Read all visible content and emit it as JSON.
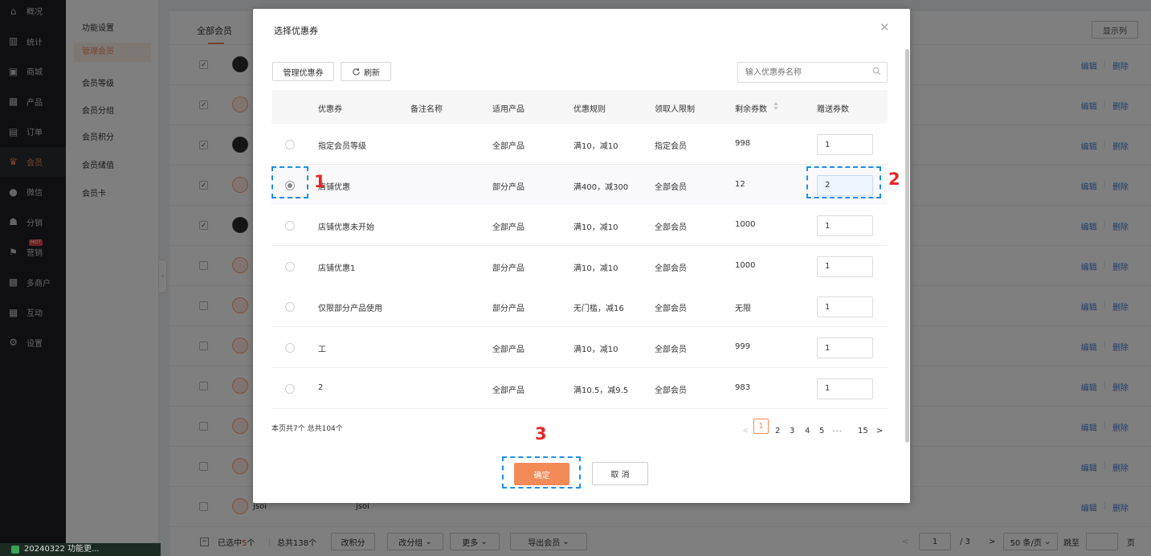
{
  "nav": {
    "items": [
      {
        "label": "概况",
        "icon": "graduation-cap-icon",
        "glyph": "⌂"
      },
      {
        "label": "统计",
        "icon": "chart-icon",
        "glyph": "▥"
      },
      {
        "label": "商城",
        "icon": "shop-icon",
        "glyph": "▣"
      },
      {
        "label": "产品",
        "icon": "grid-icon",
        "glyph": "▦"
      },
      {
        "label": "订单",
        "icon": "order-icon",
        "glyph": "▤"
      },
      {
        "label": "会员",
        "icon": "crown-icon",
        "glyph": "♛"
      },
      {
        "label": "微信",
        "icon": "wechat-icon",
        "glyph": "●"
      },
      {
        "label": "分销",
        "icon": "users-icon",
        "glyph": "☗"
      },
      {
        "label": "营销",
        "icon": "flag-icon",
        "glyph": "⚑"
      },
      {
        "label": "多商户",
        "icon": "merchant-icon",
        "glyph": "▩"
      },
      {
        "label": "互动",
        "icon": "interact-icon",
        "glyph": "▦"
      },
      {
        "label": "设置",
        "icon": "gear-icon",
        "glyph": "⚙"
      }
    ],
    "active_index": 5,
    "hot_badge": "HOT"
  },
  "subnav": {
    "items": [
      "功能设置",
      "管理会员",
      "会员等级",
      "会员分组",
      "会员积分",
      "会员储值",
      "会员卡"
    ],
    "active_index": 1
  },
  "page": {
    "tab": "全部会员",
    "show_columns": "显示列",
    "row_ops": {
      "edit": "编辑",
      "delete": "删除"
    },
    "last_row_name": "jsoi",
    "last_row_name2": "jsoi",
    "footer": {
      "selected_prefix": "已选中",
      "selected_count": "5",
      "selected_suffix": "个",
      "total": "总共138个",
      "change_points": "改积分",
      "change_group": "改分组",
      "more": "更多",
      "export": "导出会员",
      "current_page": "1",
      "total_pages": "/ 3",
      "page_size": "50 条/页",
      "jump_to": "跳至",
      "page_unit": "页"
    }
  },
  "taskbar": {
    "text": "20240322 功能更..."
  },
  "modal": {
    "title": "选择优惠券",
    "manage_btn": "管理优惠券",
    "refresh_btn": "刷新",
    "search_placeholder": "输入优惠券名称",
    "columns": {
      "coupon": "优惠券",
      "remark": "备注名称",
      "product": "适用产品",
      "rule": "优惠规则",
      "limit": "领取人限制",
      "remaining": "剩余券数",
      "gift": "赠送券数"
    },
    "rows": [
      {
        "name": "指定会员等级",
        "remark": "",
        "product": "全部产品",
        "rule": "满10，减10",
        "limit": "指定会员",
        "remaining": "998",
        "qty": "1"
      },
      {
        "name": "店铺优惠",
        "remark": "",
        "product": "部分产品",
        "rule": "满400，减300",
        "limit": "全部会员",
        "remaining": "12",
        "qty": "2"
      },
      {
        "name": "店铺优惠未开始",
        "remark": "",
        "product": "全部产品",
        "rule": "满10，减10",
        "limit": "全部会员",
        "remaining": "1000",
        "qty": "1"
      },
      {
        "name": "店铺优惠1",
        "remark": "",
        "product": "部分产品",
        "rule": "满10，减10",
        "limit": "全部会员",
        "remaining": "1000",
        "qty": "1"
      },
      {
        "name": "仅限部分产品使用",
        "remark": "",
        "product": "部分产品",
        "rule": "无门槛，减16",
        "limit": "全部会员",
        "remaining": "无限",
        "qty": "1"
      },
      {
        "name": "工",
        "remark": "",
        "product": "全部产品",
        "rule": "满10，减10",
        "limit": "全部会员",
        "remaining": "999",
        "qty": "1"
      },
      {
        "name": "2",
        "remark": "",
        "product": "全部产品",
        "rule": "满10.5，减9.5",
        "limit": "全部会员",
        "remaining": "983",
        "qty": "1"
      }
    ],
    "selected_row": 1,
    "summary": "本页共7个 总共104个",
    "pagination": {
      "prev": "<",
      "current": "1",
      "pages": [
        "2",
        "3",
        "4",
        "5"
      ],
      "ellipsis": "•••",
      "last": "15",
      "next": ">"
    },
    "confirm": "确定",
    "cancel": "取 消"
  },
  "annotations": [
    "1",
    "2",
    "3"
  ]
}
